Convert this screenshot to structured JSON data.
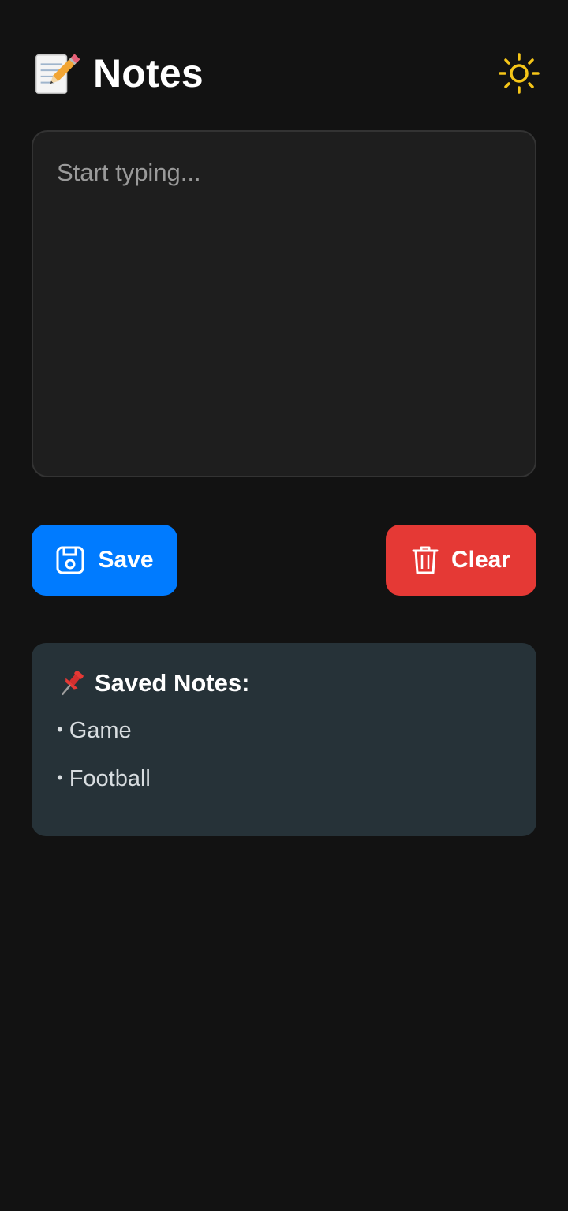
{
  "header": {
    "title": "Notes",
    "title_icon": "memo-icon",
    "theme_toggle_icon": "sun-icon"
  },
  "editor": {
    "placeholder": "Start typing...",
    "value": ""
  },
  "actions": {
    "save_label": "Save",
    "save_icon": "floppy-disk-icon",
    "clear_label": "Clear",
    "clear_icon": "trash-icon"
  },
  "saved": {
    "title": "Saved Notes:",
    "title_icon": "pushpin-icon",
    "bullet": "•",
    "items": [
      "Game",
      "Football"
    ]
  },
  "colors": {
    "background": "#121212",
    "editor_bg": "#1e1e1e",
    "save": "#007bff",
    "clear": "#e53935",
    "saved_panel": "#263238",
    "sun": "#f5c518"
  }
}
